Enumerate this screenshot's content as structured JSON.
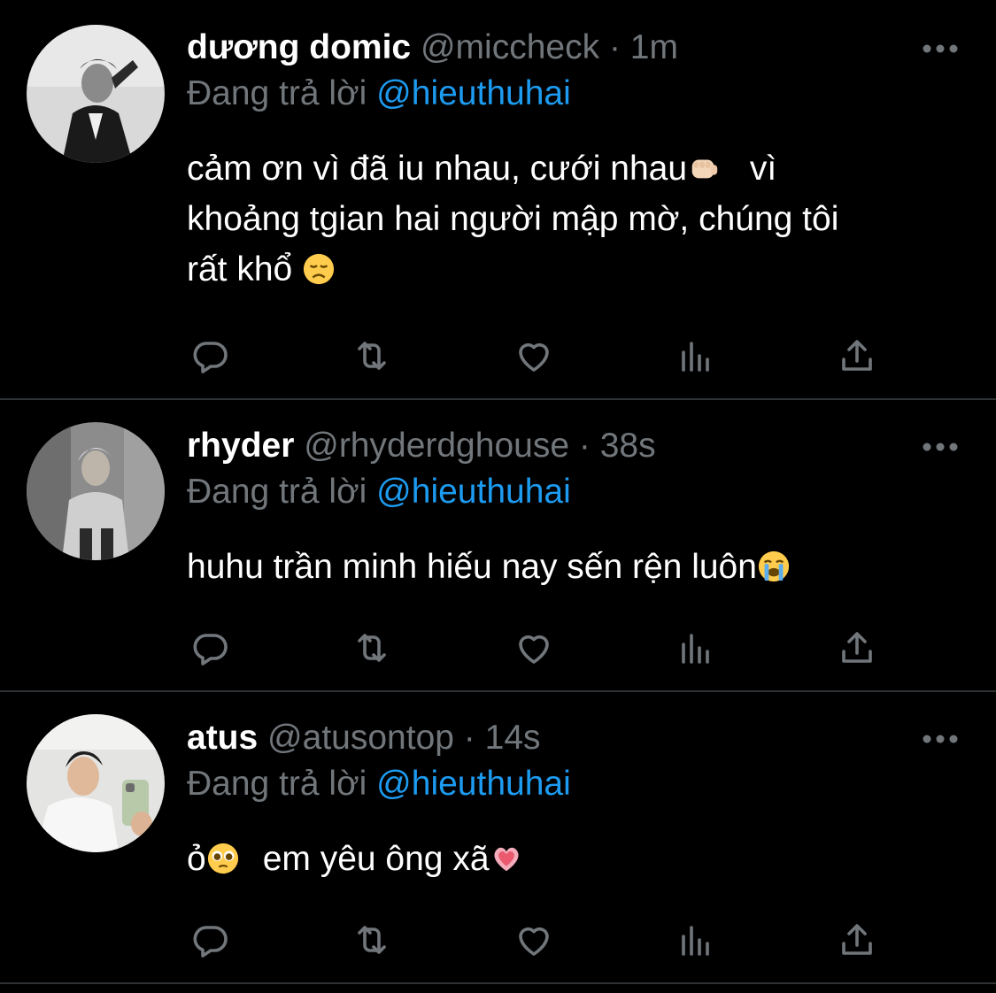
{
  "tweets": [
    {
      "name": "dương domic",
      "handle": "@miccheck",
      "separator": "·",
      "time": "1m",
      "reply_prefix": "Đang trả lời",
      "reply_to": "@hieuthuhai",
      "text_lines": [
        [
          "cảm ơn vì đã iu nhau, cưới nhau",
          "fist-emoji",
          "  vì"
        ],
        [
          "khoảng tgian hai người mập mờ, chúng tôi"
        ],
        [
          "rất khổ ",
          "disappointed-face-emoji"
        ]
      ],
      "line1": "cảm ơn vì đã iu nhau, cưới nhau",
      "line1_tail": " vì",
      "line2": "khoảng tgian hai người mập mờ, chúng tôi",
      "line3": "rất khổ "
    },
    {
      "name": "rhyder",
      "handle": "@rhyderdghouse",
      "separator": "·",
      "time": "38s",
      "reply_prefix": "Đang trả lời",
      "reply_to": "@hieuthuhai",
      "line1": "huhu trần minh hiếu nay sến rện luôn"
    },
    {
      "name": "atus",
      "handle": "@atusontop",
      "separator": "·",
      "time": "14s",
      "reply_prefix": "Đang trả lời",
      "reply_to": "@hieuthuhai",
      "line1_a": "ỏ",
      "line1_b": "em yêu ông xã"
    }
  ],
  "colors": {
    "background": "#000000",
    "primary_text": "#ffffff",
    "secondary_text": "#71767b",
    "accent": "#1d9bf0",
    "divider": "#2f3336"
  },
  "icons": {
    "more": "more-horizontal-icon",
    "reply": "reply-icon",
    "retweet": "retweet-icon",
    "like": "like-icon",
    "views": "views-icon",
    "share": "share-icon"
  }
}
